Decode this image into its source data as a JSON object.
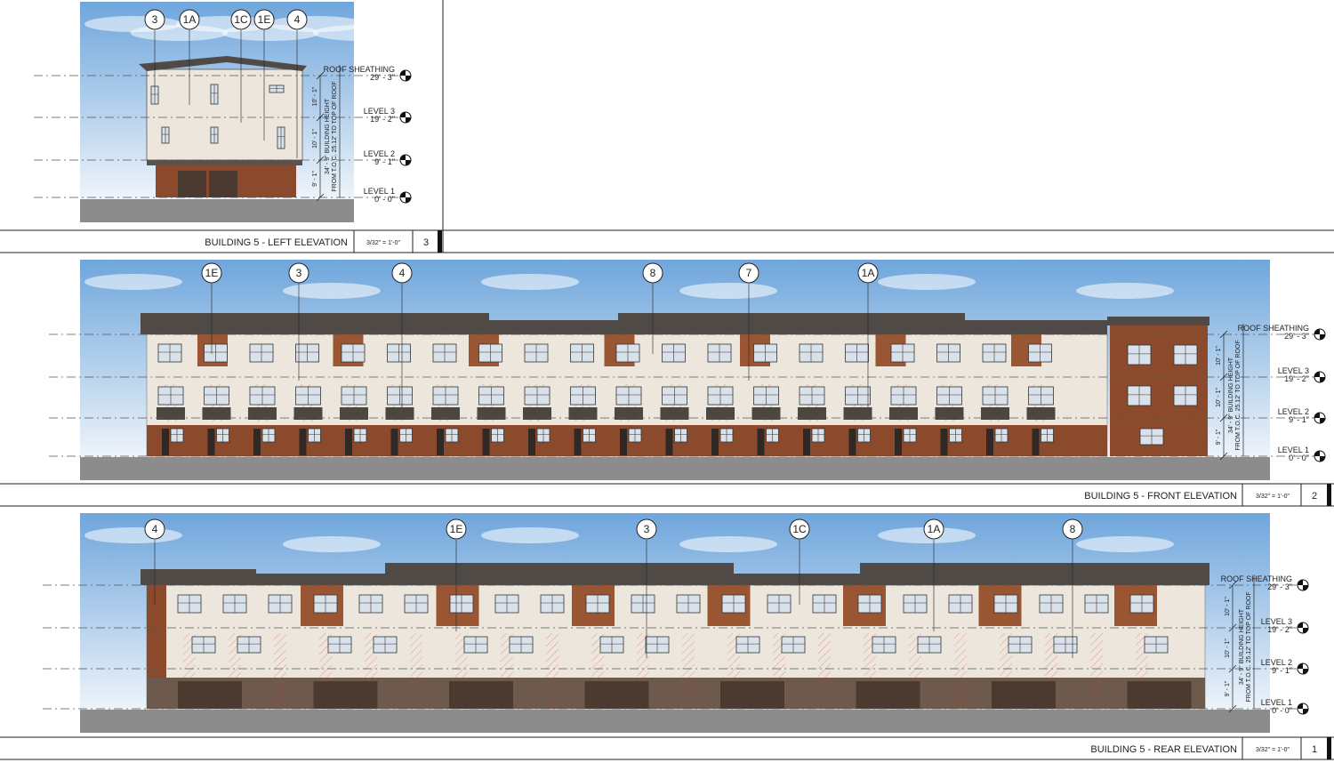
{
  "sheet": {
    "colors": {
      "sky_top": "#6fa6dc",
      "sky_bottom": "#e6f0f8",
      "ground": "#8c8c8c",
      "siding_light": "#ece6dc",
      "siding_brown": "#8b4a2b",
      "roof": "#4f4a46",
      "garage": "#4a3a30",
      "window": "#d9e2ea",
      "accent_red": "#d23a3a"
    }
  },
  "elevations": [
    {
      "id": "left",
      "title": "BUILDING 5 - LEFT ELEVATION",
      "scale": "3/32\" = 1'-0\"",
      "number": "3",
      "tags": [
        "3",
        "1A",
        "1C",
        "1E",
        "4"
      ],
      "levels": [
        {
          "name": "ROOF SHEATHING",
          "elev": "29' - 3\""
        },
        {
          "name": "LEVEL 3",
          "elev": "19' - 2\""
        },
        {
          "name": "LEVEL 2",
          "elev": "9' - 1\""
        },
        {
          "name": "LEVEL 1",
          "elev": "0' - 0\""
        }
      ],
      "dims": [
        "10' - 1\"",
        "10' - 1\"",
        "9' - 1\""
      ],
      "height_note_1": "34' - 9\" BUILDING HEIGHT",
      "height_note_2": "FROM T.O.C. 25.12' TO TOP OF ROOF"
    },
    {
      "id": "front",
      "title": "BUILDING 5 - FRONT ELEVATION",
      "scale": "3/32\" = 1'-0\"",
      "number": "2",
      "tags": [
        "1E",
        "3",
        "4",
        "8",
        "7",
        "1A"
      ],
      "levels": [
        {
          "name": "ROOF SHEATHING",
          "elev": "29' - 3\""
        },
        {
          "name": "LEVEL 3",
          "elev": "19' - 2\""
        },
        {
          "name": "LEVEL 2",
          "elev": "9' - 1\""
        },
        {
          "name": "LEVEL 1",
          "elev": "0' - 0\""
        }
      ],
      "dims": [
        "10' - 1\"",
        "10' - 1\"",
        "9' - 1\""
      ],
      "height_note_1": "34' - 9\" BUILDING HEIGHT",
      "height_note_2": "FROM T.O.C. 25.12' TO TOP OF ROOF"
    },
    {
      "id": "rear",
      "title": "BUILDING 5 - REAR ELEVATION",
      "scale": "3/32\" = 1'-0\"",
      "number": "1",
      "tags": [
        "4",
        "1E",
        "3",
        "1C",
        "1A",
        "8"
      ],
      "levels": [
        {
          "name": "ROOF SHEATHING",
          "elev": "29' - 3\""
        },
        {
          "name": "LEVEL 3",
          "elev": "19' - 2\""
        },
        {
          "name": "LEVEL 2",
          "elev": "9' - 1\""
        },
        {
          "name": "LEVEL 1",
          "elev": "0' - 0\""
        }
      ],
      "dims": [
        "10' - 1\"",
        "10' - 1\"",
        "9' - 1\""
      ],
      "height_note_1": "34' - 9\" BUILDING HEIGHT",
      "height_note_2": "FROM T.O.C. 25.12' TO TOP OF ROOF"
    }
  ]
}
